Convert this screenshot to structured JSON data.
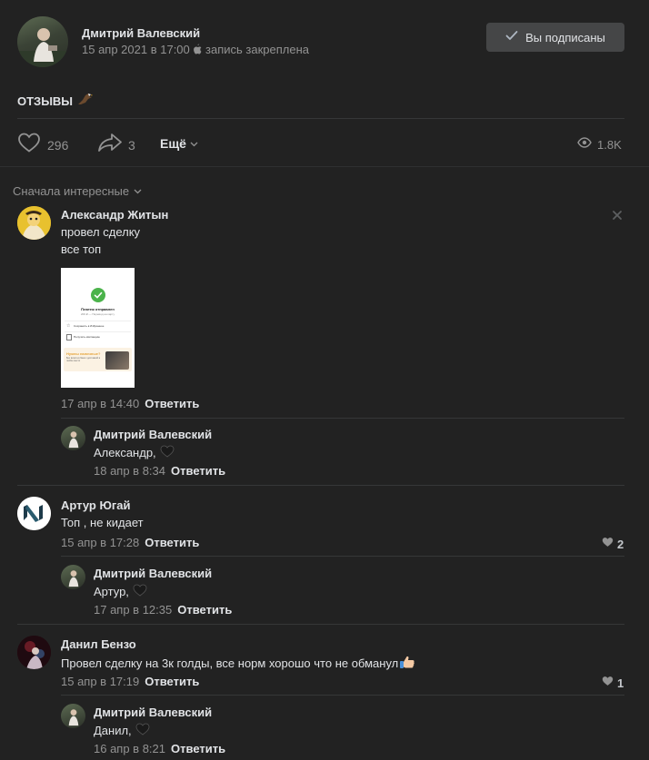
{
  "post": {
    "author": "Дмитрий Валевский",
    "date": "15 апр 2021 в 17:00",
    "pinned": "запись закреплена",
    "subscribe_label": "Вы подписаны",
    "text": "ОТЗЫВЫ",
    "likes": "296",
    "shares": "3",
    "more_label": "Ещё",
    "views": "1.8K"
  },
  "sort_label": "Сначала интересные",
  "receipt": {
    "title": "Платеж отправлен",
    "subtitle": "200 ₽ — Перевод на карту",
    "item1": "Сохранить в Избранное",
    "item2": "Получить квитанцию",
    "promo_title": "Нужны наличные?",
    "promo_text": "Без визита в банк с доставкой в любое место"
  },
  "comments": [
    {
      "author": "Александр Житын",
      "line1": "провел сделку",
      "line2": "все топ",
      "date": "17 апр в 14:40",
      "reply_label": "Ответить",
      "reply": {
        "author": "Дмитрий Валевский",
        "text": "Александр,",
        "date": "18 апр в 8:34",
        "reply_label": "Ответить"
      }
    },
    {
      "author": "Артур Югай",
      "text": "Топ , не кидает",
      "date": "15 апр в 17:28",
      "reply_label": "Ответить",
      "likes": "2",
      "reply": {
        "author": "Дмитрий Валевский",
        "text": "Артур,",
        "date": "17 апр в 12:35",
        "reply_label": "Ответить"
      }
    },
    {
      "author": "Данил Бензо",
      "text": "Провел сделку на 3к голды, все норм хорошо что не обманул",
      "date": "15 апр в 17:19",
      "reply_label": "Ответить",
      "likes": "1",
      "reply": {
        "author": "Дмитрий Валевский",
        "text": "Данил,",
        "date": "16 апр в 8:21",
        "reply_label": "Ответить"
      }
    }
  ],
  "colors": {
    "background": "#222222",
    "button": "#454647",
    "muted": "#939393",
    "text": "#e1e3e6",
    "check": "#4bb34b"
  }
}
